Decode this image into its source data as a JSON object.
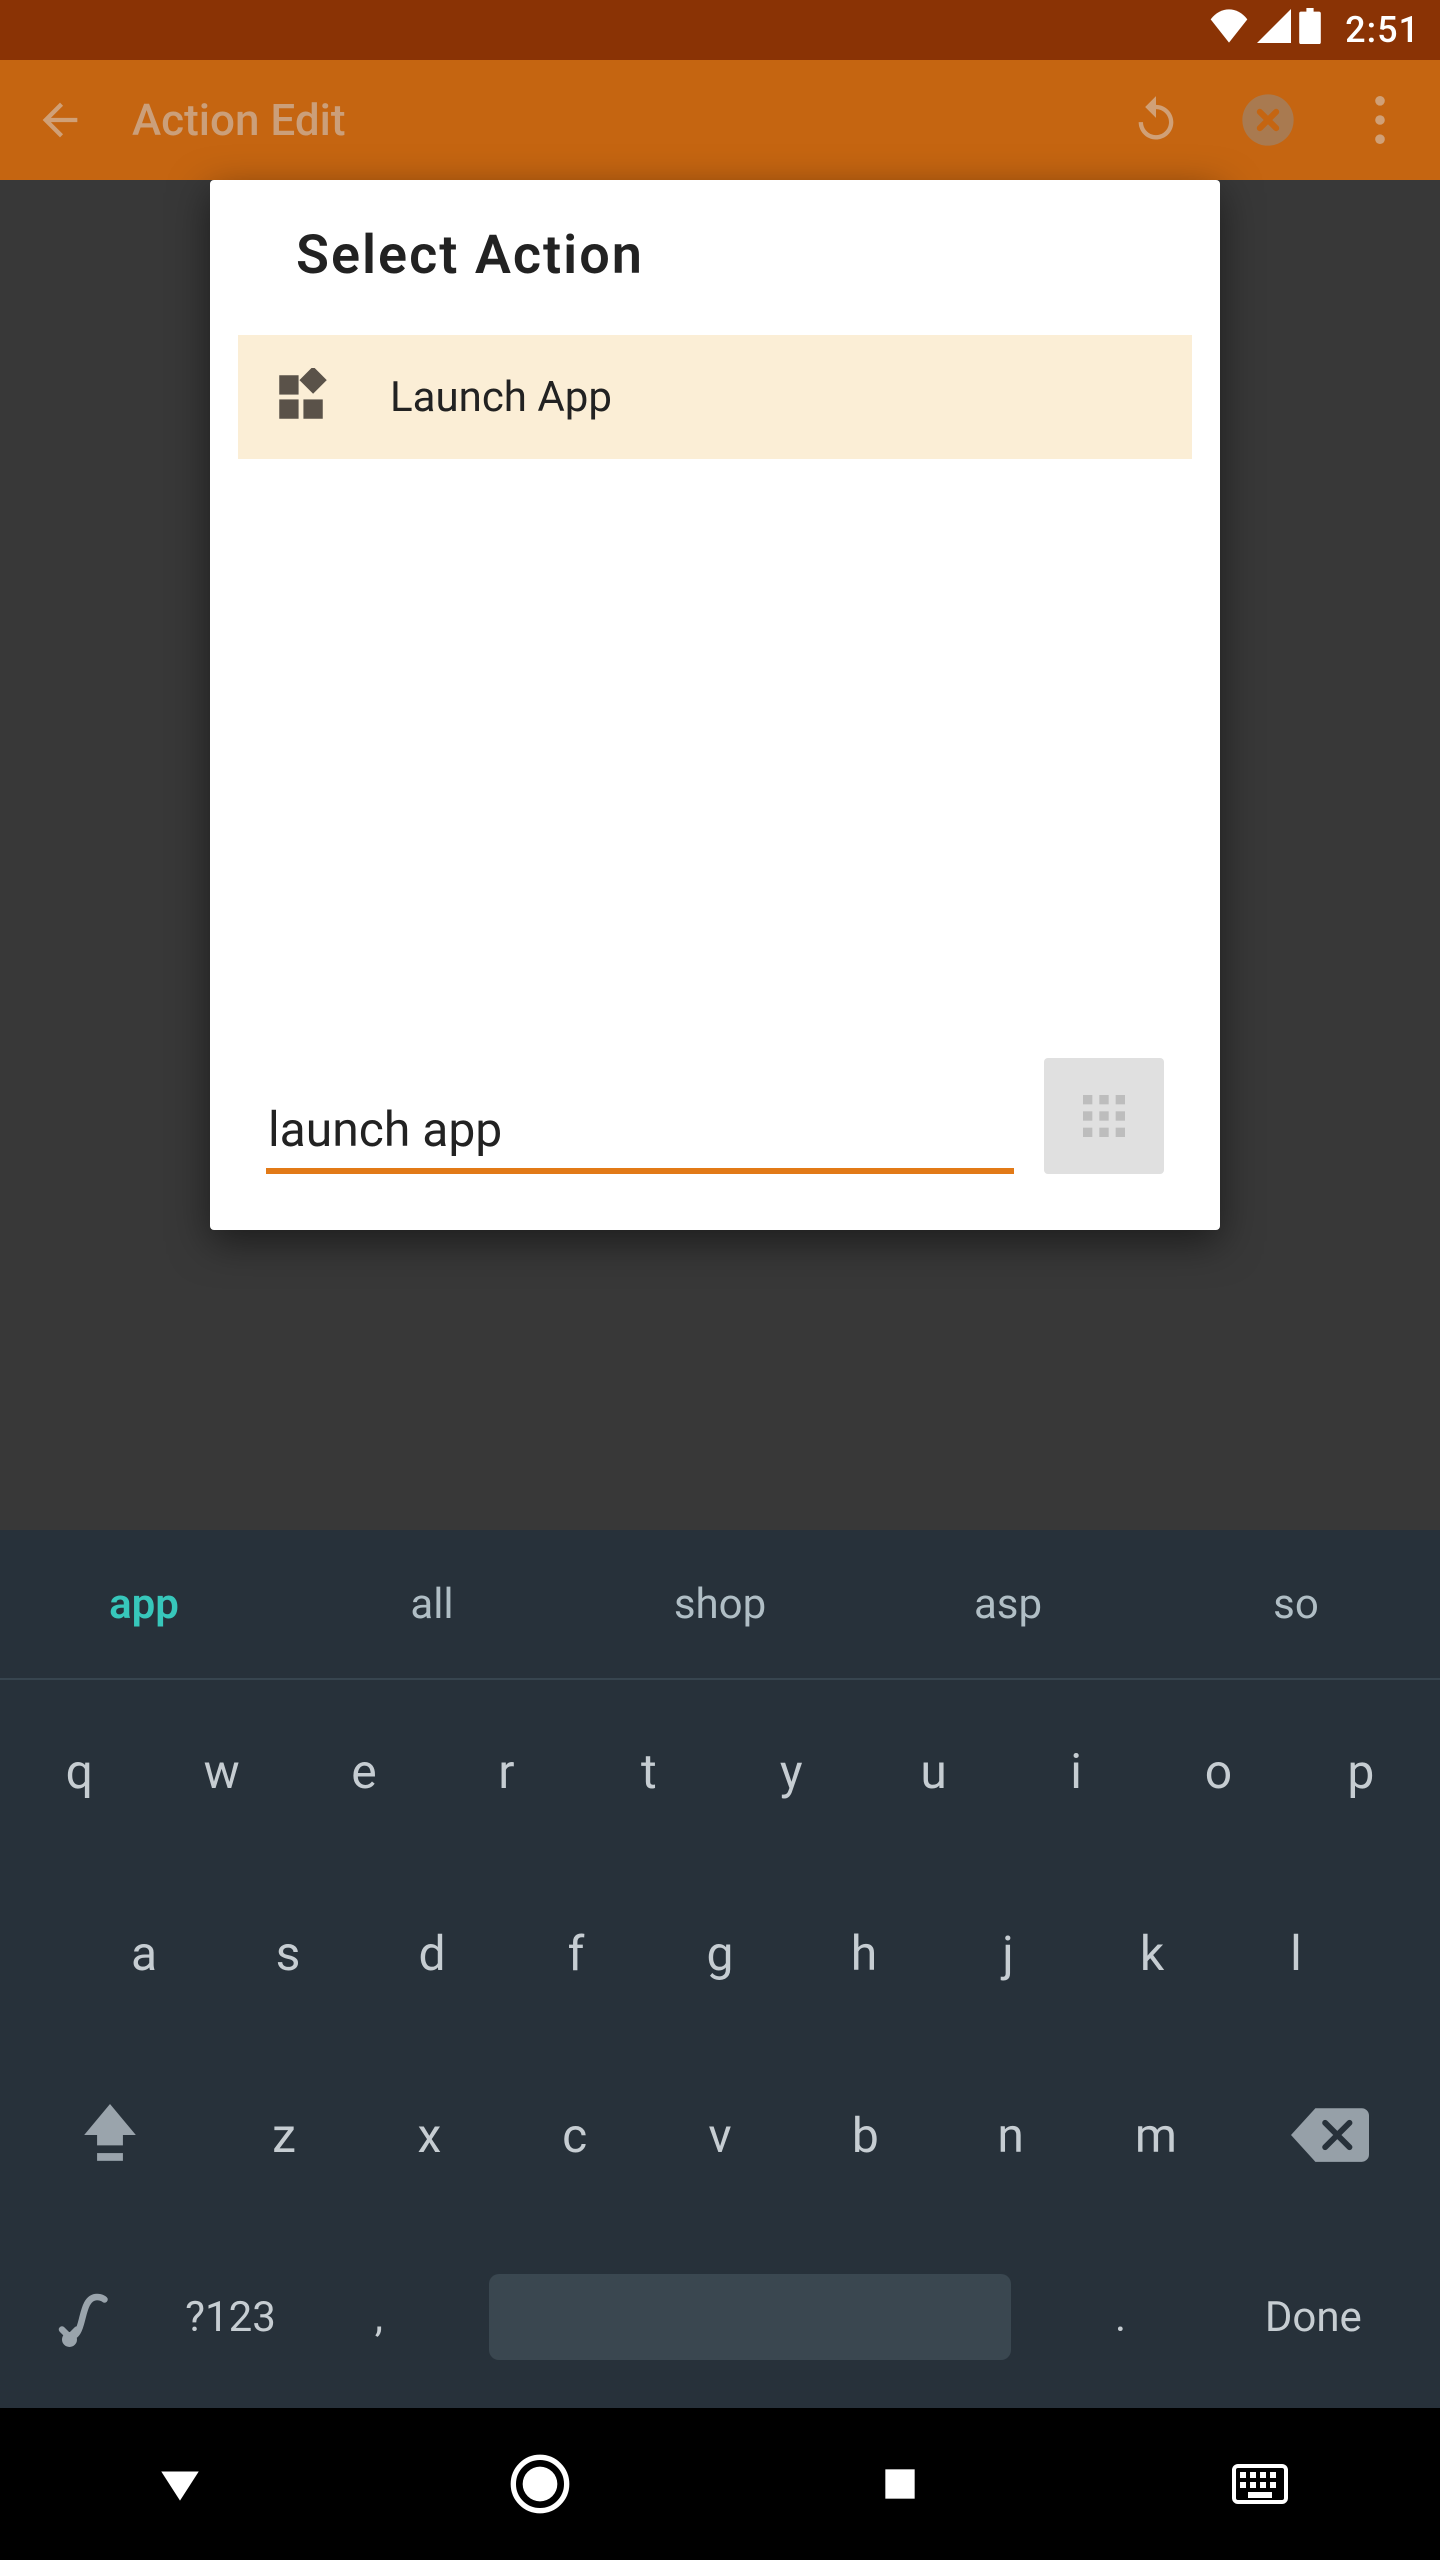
{
  "status": {
    "time": "2:51"
  },
  "appbar": {
    "title": "Action Edit"
  },
  "dialog": {
    "title": "Select  Action",
    "results": [
      {
        "label": "Launch App",
        "icon": "widgets-icon"
      }
    ],
    "input_value": "launch app"
  },
  "keyboard": {
    "suggestions": [
      "app",
      "all",
      "shop",
      "asp",
      "so"
    ],
    "row1": [
      "q",
      "w",
      "e",
      "r",
      "t",
      "y",
      "u",
      "i",
      "o",
      "p"
    ],
    "row2": [
      "a",
      "s",
      "d",
      "f",
      "g",
      "h",
      "j",
      "k",
      "l"
    ],
    "row3": [
      "z",
      "x",
      "c",
      "v",
      "b",
      "n",
      "m"
    ],
    "symbols_label": "?123",
    "comma": ",",
    "period": ".",
    "done_label": "Done"
  },
  "colors": {
    "accent": "#e27a17",
    "appbar_bg": "#c56511",
    "status_bg": "#8a3305",
    "keyboard_bg": "#27313a",
    "suggestion_active": "#37c7bb",
    "result_highlight": "#fbeed6"
  }
}
